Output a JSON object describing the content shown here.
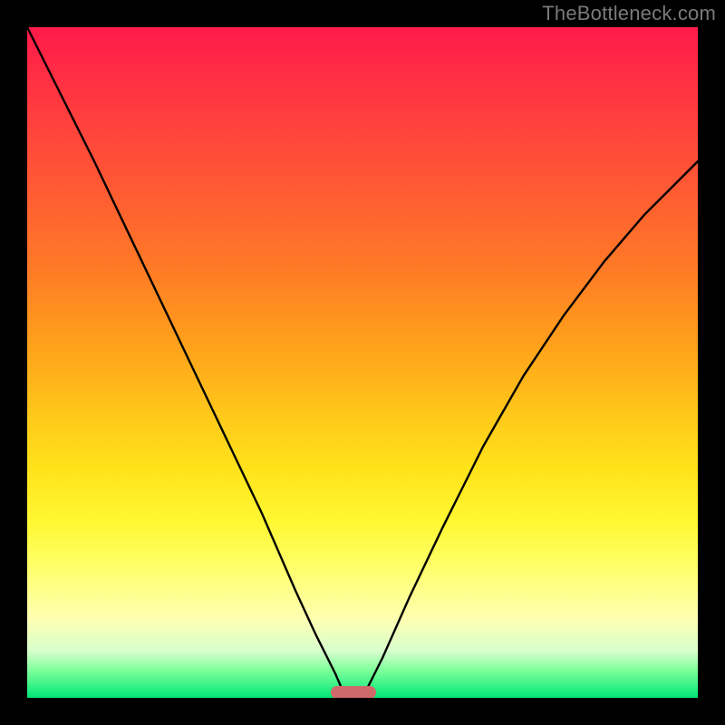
{
  "watermark": "TheBottleneck.com",
  "pill": {
    "x_frac": 0.487,
    "y_frac": 0.992,
    "color": "#d06a6a"
  },
  "chart_data": {
    "type": "line",
    "title": "",
    "xlabel": "",
    "ylabel": "",
    "xlim": [
      0,
      1
    ],
    "ylim": [
      0,
      1
    ],
    "grid": false,
    "legend": false,
    "note": "V-shaped bottleneck curve; x is normalized component balance, y is bottleneck severity (0 at bottom/green = no bottleneck, 1 at top/red = max). Minimum at x≈0.487 with a small flat segment (pill marker). Values estimated from plotted curve.",
    "series": [
      {
        "name": "left-branch",
        "x": [
          0.0,
          0.05,
          0.1,
          0.15,
          0.2,
          0.25,
          0.3,
          0.35,
          0.4,
          0.43,
          0.46,
          0.475
        ],
        "y": [
          1.0,
          0.9,
          0.8,
          0.695,
          0.59,
          0.485,
          0.38,
          0.275,
          0.16,
          0.095,
          0.035,
          0.0
        ]
      },
      {
        "name": "right-branch",
        "x": [
          0.5,
          0.53,
          0.57,
          0.62,
          0.68,
          0.74,
          0.8,
          0.86,
          0.92,
          0.96,
          1.0
        ],
        "y": [
          0.0,
          0.06,
          0.15,
          0.255,
          0.375,
          0.48,
          0.57,
          0.65,
          0.72,
          0.76,
          0.8
        ]
      }
    ],
    "gradient_stops": [
      {
        "pos": 0.0,
        "color": "#ff1a4a"
      },
      {
        "pos": 0.12,
        "color": "#ff3b3f"
      },
      {
        "pos": 0.24,
        "color": "#ff5a33"
      },
      {
        "pos": 0.36,
        "color": "#ff7a26"
      },
      {
        "pos": 0.48,
        "color": "#ffa31a"
      },
      {
        "pos": 0.58,
        "color": "#ffc91a"
      },
      {
        "pos": 0.66,
        "color": "#ffe31a"
      },
      {
        "pos": 0.74,
        "color": "#fff833"
      },
      {
        "pos": 0.8,
        "color": "#ffff66"
      },
      {
        "pos": 0.88,
        "color": "#ffffb0"
      },
      {
        "pos": 0.93,
        "color": "#d8ffcc"
      },
      {
        "pos": 0.96,
        "color": "#7aff99"
      },
      {
        "pos": 1.0,
        "color": "#00e676"
      }
    ]
  }
}
